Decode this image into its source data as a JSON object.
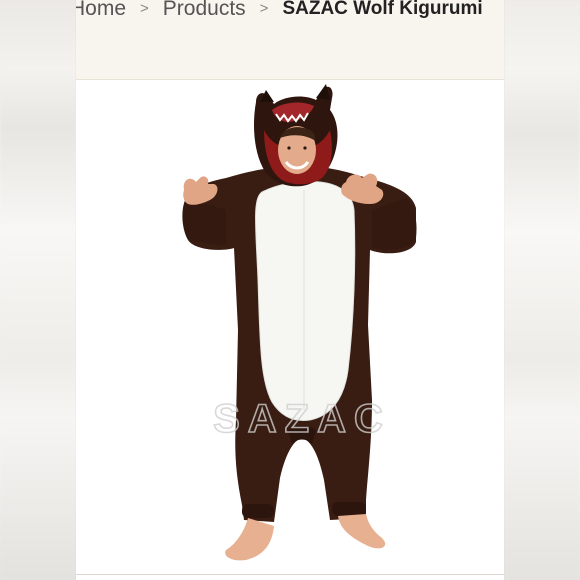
{
  "breadcrumb": {
    "home": "Home",
    "separator": ">",
    "products": "Products",
    "current": "SAZAC Wolf Kigurumi"
  },
  "product_image": {
    "watermark": "SAZAC",
    "alt": "SAZAC Wolf Kigurumi"
  },
  "colors": {
    "header_bg": "#f8f5ee",
    "costume_brown": "#3a1d12",
    "costume_belly": "#f6f6f3",
    "hood_lining": "#8e1a1a"
  }
}
